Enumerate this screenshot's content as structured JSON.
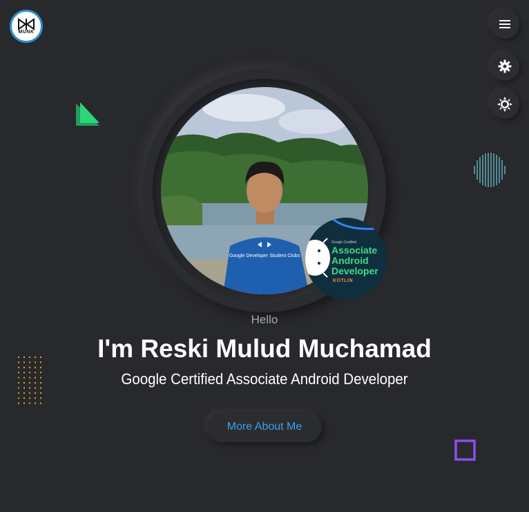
{
  "header": {
    "logo_text": "MUNK",
    "menu_icon": "hamburger-icon",
    "settings_icon": "gear-icon",
    "theme_icon": "sun-icon"
  },
  "hero": {
    "greeting": "Hello",
    "name": "I'm Reski Mulud Muchamad",
    "role": "Google Certified Associate Android Developer",
    "button_label": "More About Me",
    "photo_shirt_text": "Google Developer Student Clubs"
  },
  "badge": {
    "small_text": "Google Certified",
    "line1": "Associate",
    "line2": "Android",
    "line3": "Developer",
    "language": "KOTLIN"
  },
  "colors": {
    "background": "#28292d",
    "accent": "#3aa2e8",
    "triangle": "#2ed47a",
    "dots": "#f0a020",
    "square": "#8a4ff0",
    "lines": "#6fd0e0"
  }
}
